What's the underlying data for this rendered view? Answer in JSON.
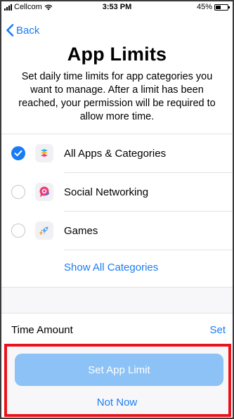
{
  "status_bar": {
    "carrier": "Cellcom",
    "time": "3:53 PM",
    "battery_percent": "45%",
    "battery_level": 0.45
  },
  "nav": {
    "back_label": "Back"
  },
  "header": {
    "title": "App Limits",
    "description": "Set daily time limits for app categories you want to manage. After a limit has been reached, your permission will be required to allow more time."
  },
  "categories": [
    {
      "label": "All Apps & Categories",
      "selected": true,
      "icon": "stack-icon"
    },
    {
      "label": "Social Networking",
      "selected": false,
      "icon": "chat-bubble-icon"
    },
    {
      "label": "Games",
      "selected": false,
      "icon": "rocket-icon"
    }
  ],
  "show_all_label": "Show All Categories",
  "time_amount": {
    "label": "Time Amount",
    "action": "Set"
  },
  "buttons": {
    "primary": "Set App Limit",
    "secondary": "Not Now"
  },
  "colors": {
    "accent": "#1a7cf5",
    "primary_disabled": "#8cc2f6",
    "highlight": "#e8141b"
  }
}
